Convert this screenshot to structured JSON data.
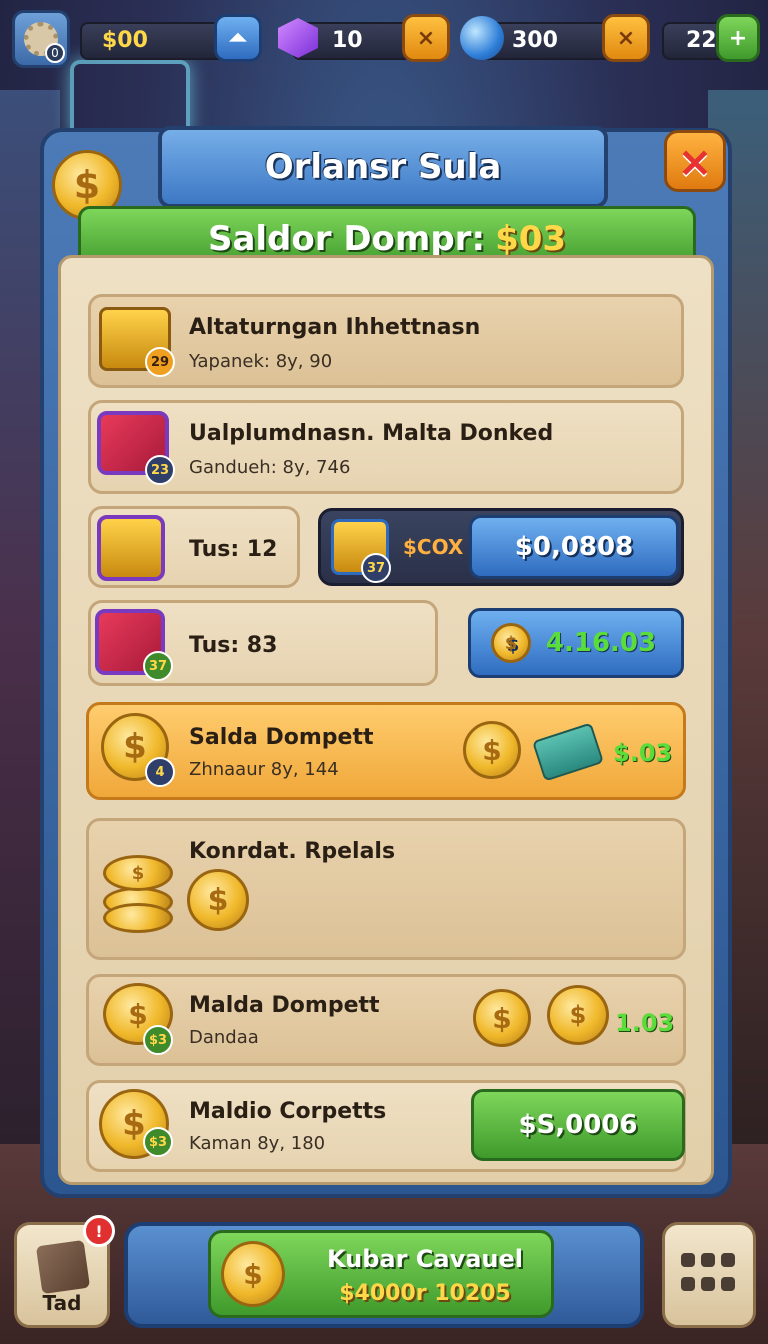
{
  "hud": {
    "avatar_badge": "0",
    "coins": "$00",
    "gems": "10",
    "orbs": "300",
    "level": "22",
    "add_symbol": "+",
    "x_symbol": "×"
  },
  "dialog": {
    "title": "Orlansr Sula",
    "balance_label": "Saldor Dompr:",
    "balance_value": "$03",
    "close_symbol": "×"
  },
  "rows": [
    {
      "title": "Altaturngan Ihhettnasn",
      "sub": "Yapanek: 8y, 90",
      "badge": "29"
    },
    {
      "title": "Ualplumdnasn. Malta Donked",
      "sub": "Gandueh: 8y, 746",
      "badge": "23"
    },
    {
      "title": "Tus: 12",
      "offer_label": "$COX",
      "offer_badge": "37",
      "price": "$0,0808"
    },
    {
      "title": "Tus: 83",
      "badge": "37",
      "price": "4.16.03"
    },
    {
      "title": "Salda Dompett",
      "sub": "Zhnaaur 8y, 144",
      "badge": "4",
      "value": "$.03"
    },
    {
      "title": "Konrdat. Rpelals"
    },
    {
      "title": "Malda Dompett",
      "sub": "Dandaa",
      "badge": "$3",
      "value": "1.03"
    },
    {
      "title": "Maldio Corpetts",
      "sub": "Kaman 8y, 180",
      "badge": "$3",
      "price": "$S,0006"
    }
  ],
  "bottom": {
    "left_label": "Tad",
    "left_alert": "!",
    "cta_title": "Kubar Cavauel",
    "cta_value": "$4000r 10205"
  },
  "colors": {
    "panel_blue": "#2c5690",
    "parchment": "#e2cfaa",
    "green_button": "#3f9a2c",
    "gold_highlight": "#f0a83a",
    "gold_text": "#ffd84a"
  }
}
